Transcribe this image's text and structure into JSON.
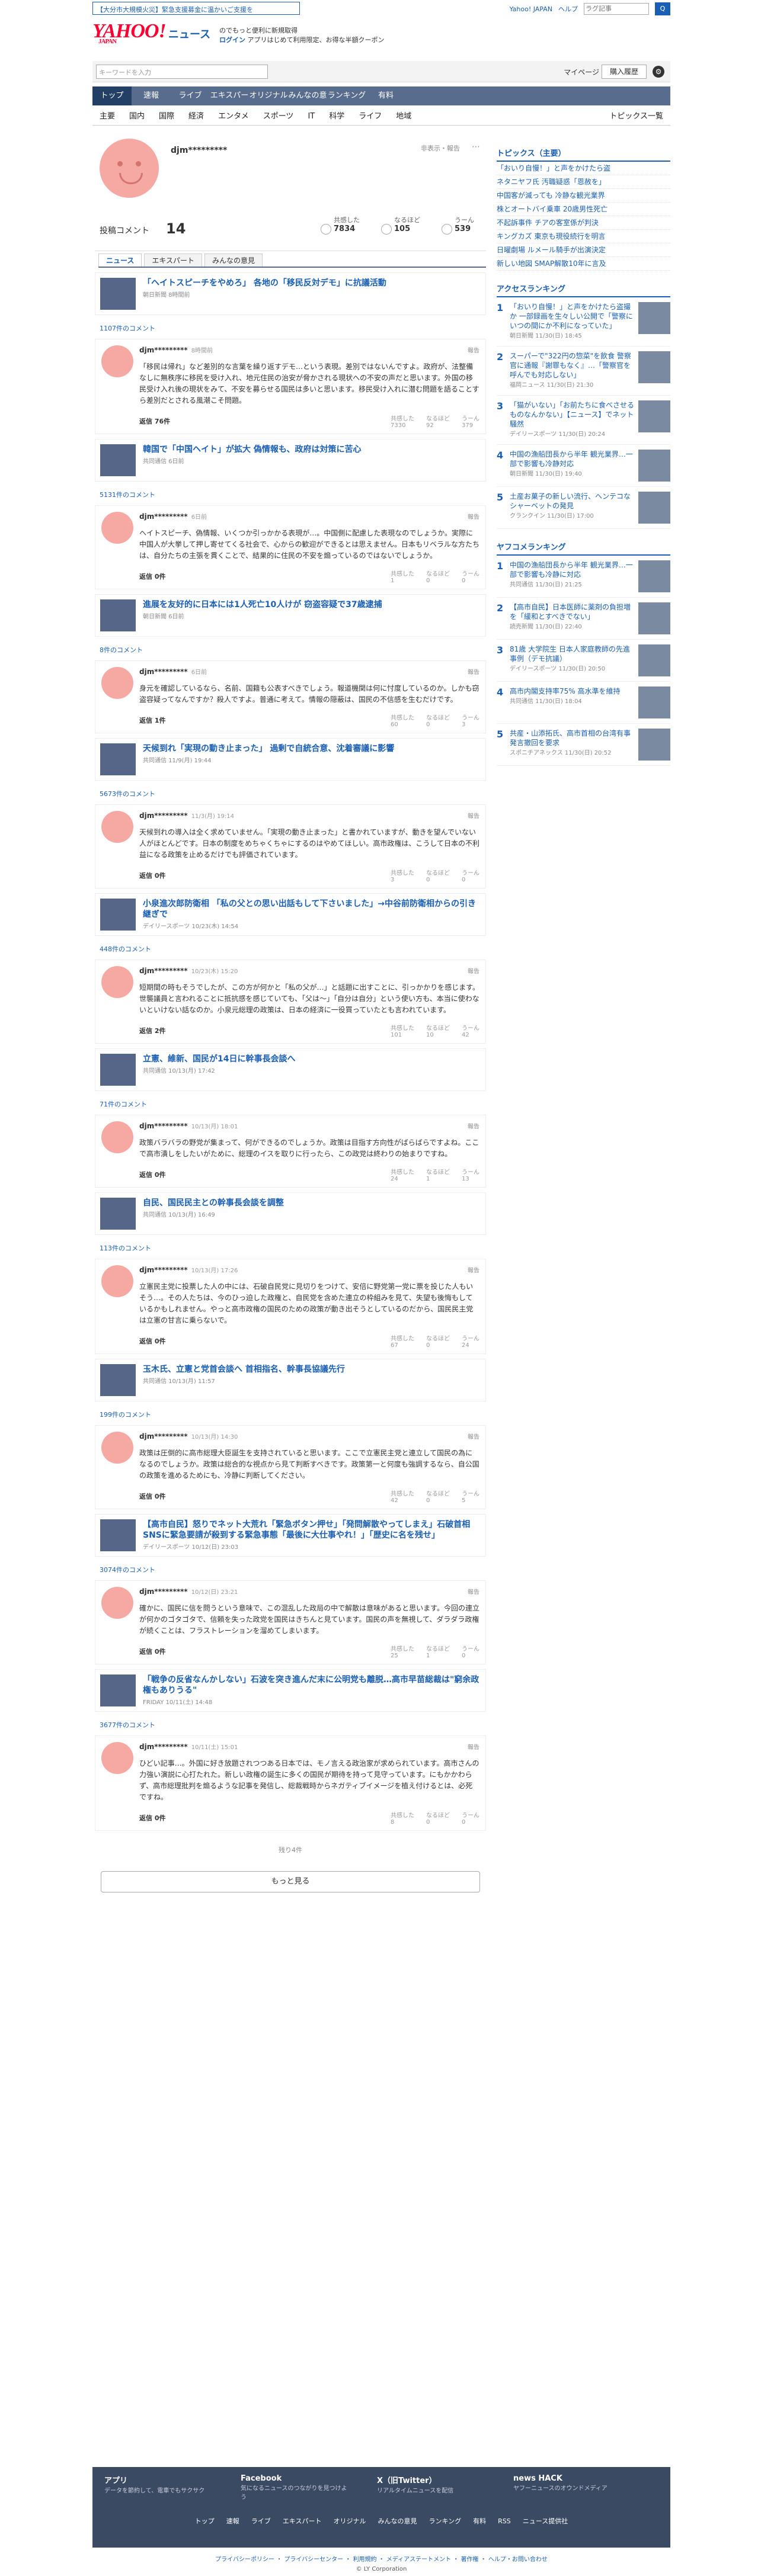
{
  "alert": "【大分市大規模火災】緊急支援募金に温かいご支援を",
  "topright": {
    "yj": "Yahoo! JAPAN",
    "help": "ヘルプ",
    "search_ph": "ラグ記事",
    "search_btn": "Q"
  },
  "brand": {
    "logo": "YAHOO!",
    "sub": "JAPAN",
    "news": "ニュース"
  },
  "promo": {
    "line1": "のでもっと便利に新規取得",
    "login": "ログイン",
    "line2": "アプリはじめて利用限定、お得な半額クーポン"
  },
  "searchbar": {
    "placeholder": "キーワードを入力",
    "mypage": "マイページ",
    "purchase": "購入履歴"
  },
  "gnav": [
    "トップ",
    "速報",
    "ライブ",
    "エキスパート",
    "オリジナル",
    "みんなの意見",
    "ランキング",
    "有料"
  ],
  "subnav": [
    "主要",
    "国内",
    "国際",
    "経済",
    "エンタメ",
    "スポーツ",
    "IT",
    "科学",
    "ライフ",
    "地域"
  ],
  "subnav_right": "トピックス一覧",
  "profile": {
    "name": "djm*********",
    "hide": "非表示・報告",
    "count_label": "投稿コメント",
    "count": "14",
    "s1": "共感した",
    "v1": "7834",
    "s2": "なるほど",
    "v2": "105",
    "s3": "うーん",
    "v3": "539"
  },
  "tabs": [
    "ニュース",
    "エキスパート",
    "みんなの意見"
  ],
  "items": [
    {
      "title": "「ヘイトスピーチをやめろ」 各地の「移民反対デモ」に抗議活動",
      "src": "朝日新聞 8時間前",
      "cc": "1107件のコメント",
      "name": "djm*********",
      "time": "8時間前",
      "text": "「移民は帰れ」など差別的な言葉を繰り返すデモ…という表現。差別ではないんですよ。政府が、法整備なしに無秩序に移民を受け入れ、地元住民の治安が脅かされる現状への不安の声だと思います。外国の移民受け入れ後の現状をみて、不安を募らせる国民は多いと思います。移民受け入れに潜む問題を語ることすら差別だとされる風潮こそ問題。",
      "r1": "7330",
      "r2": "92",
      "r3": "379",
      "reply": "返信 76件"
    },
    {
      "title": "韓国で「中国ヘイト」が拡大 偽情報も、政府は対策に苦心",
      "src": "共同通信 6日前",
      "cc": "5131件のコメント",
      "name": "djm*********",
      "time": "6日前",
      "text": "ヘイトスピーチ、偽情報、いくつか引っかかる表現が…。中国側に配慮した表現なのでしょうか。実際に中国人が大挙して押し寄せてくる社会で、心からの歓迎ができるとは思えません。日本もリベラルな方たちは、自分たちの主張を貫くことで、結果的に住民の不安を煽っているのではないでしょうか。",
      "r1": "1",
      "r2": "0",
      "r3": "0",
      "reply": "返信 0件"
    },
    {
      "title": "進展を友好的に日本には1人死亡10人けが 窃盗容疑で37歳逮捕",
      "src": "朝日新聞 6日前",
      "cc": "8件のコメント",
      "name": "djm*********",
      "time": "6日前",
      "text": "身元を確認しているなら、名前、国籍も公表すべきでしょう。報道機関は何に忖度しているのか。しかも窃盗容疑ってなんですか？殺人ですよ。普通に考えて。情報の隠蔽は、国民の不信感を生むだけです。",
      "r1": "60",
      "r2": "0",
      "r3": "3",
      "reply": "返信 1件"
    },
    {
      "title": "天候到れ「実現の動き止まった」 過剰で自統合意、沈着審議に影響",
      "src": "共同通信 11/9(月) 19:44",
      "cc": "5673件のコメント",
      "name": "djm*********",
      "time": "11/3(月) 19:14",
      "text": "天候到れの導入は全く求めていません。「実現の動き止まった」と書かれていますが、動きを望んでいない人がほとんどです。日本の制度をめちゃくちゃにするのはやめてほしい。高市政権は、こうして日本の不利益になる政策を止めるだけでも評価されています。",
      "r1": "3",
      "r2": "0",
      "r3": "0",
      "reply": "返信 0件"
    },
    {
      "title": "小泉進次郎防衛相 「私の父との思い出話もして下さいました」→中谷前防衛相からの引き継ぎで",
      "src": "デイリースポーツ 10/23(木) 14:54",
      "cc": "448件のコメント",
      "name": "djm*********",
      "time": "10/23(木) 15:20",
      "text": "短期間の時もそうでしたが、この方が何かと「私の父が…」と話題に出すことに、引っかかりを感じます。世襲議員と言われることに抵抗感を感じていても、「父は～」「自分は自分」という使い方も、本当に使わないといけない話なのか。小泉元総理の政策は、日本の経済に一役買っていたとも言われています。",
      "r1": "101",
      "r2": "10",
      "r3": "42",
      "reply": "返信 2件"
    },
    {
      "title": "立憲、維新、国民が14日に幹事長会談へ",
      "src": "共同通信 10/13(月) 17:42",
      "cc": "71件のコメント",
      "name": "djm*********",
      "time": "10/13(月) 18:01",
      "text": "政策バラバラの野党が集まって、何ができるのでしょうか。政策は目指す方向性がばらばらですよね。ここで高市潰しをしたいがために、総理のイスを取りに行ったら、この政党は終わりの始まりですね。",
      "r1": "24",
      "r2": "1",
      "r3": "13",
      "reply": "返信 0件"
    },
    {
      "title": "自民、国民民主との幹事長会談を調整",
      "src": "共同通信 10/13(月) 16:49",
      "cc": "113件のコメント",
      "name": "djm*********",
      "time": "10/13(月) 17:26",
      "text": "立憲民主党に投票した人の中には、石破自民党に見切りをつけて、安倍に野党第一党に票を投じた人もいそう…。その人たちは、今のひっ迫した政権と、自民党を含めた連立の枠組みを見て、失望も後悔もしているかもしれません。やっと高市政権の国民のための政策が動き出そうとしているのだから、国民民主党は立憲の甘言に乗らないで。",
      "r1": "67",
      "r2": "0",
      "r3": "24",
      "reply": "返信 0件"
    },
    {
      "title": "玉木氏、立憲と党首会談へ 首相指名、幹事長協議先行",
      "src": "共同通信 10/13(月) 11:57",
      "cc": "199件のコメント",
      "name": "djm*********",
      "time": "10/13(月) 14:30",
      "text": "政策は圧倒的に高市総理大臣誕生を支持されていると思います。ここで立憲民主党と連立して国民の為になるのでしょうか。政策は総合的な視点から見て判断すべきです。政策第一と何度も強調するなら、自公国の政策を進めるためにも、冷静に判断してください。",
      "r1": "42",
      "r2": "0",
      "r3": "5",
      "reply": "返信 0件"
    },
    {
      "title": "【高市自民】怒りでネット大荒れ「緊急ボタン押せ」「発問解散やってしまえ」石破首相SNSに緊急要請が殺到する緊急事態「最後に大仕事やれ！」「歴史に名を残せ」",
      "src": "デイリースポーツ 10/12(日) 23:03",
      "cc": "3074件のコメント",
      "name": "djm*********",
      "time": "10/12(日) 23:21",
      "text": "確かに、国民に信を問うという意味で、この混乱した政局の中で解散は意味があると思います。今回の連立が何かのゴタゴタで、信頼を失った政党を国民はきちんと見ています。国民の声を無視して、ダラダラ政権が続くことは、フラストレーションを溜めてしまいます。",
      "r1": "25",
      "r2": "1",
      "r3": "0",
      "reply": "返信 0件"
    },
    {
      "title": "「戦争の反省なんかしない」石波を突き進んだ末に公明党も離脱…高市早苗総裁は\"窮余政権もありうる\"",
      "src": "FRIDAY 10/11(土) 14:48",
      "cc": "3677件のコメント",
      "name": "djm*********",
      "time": "10/11(土) 15:01",
      "text": "ひどい記事…。外国に好き放題されつつある日本では、モノ言える政治家が求められています。高市さんの力強い演説に心打たれた。新しい政権の誕生に多くの国民が期待を持って見守っています。にもかかわらず、高市総理批判を煽るような記事を発信し、総裁戦時からネガティブイメージを植え付けるとは、必死ですね。",
      "r1": "8",
      "r2": "0",
      "r3": "0",
      "reply": "返信 0件"
    }
  ],
  "remain": "残り4件",
  "more": "もっと見る",
  "side": {
    "topics_h": "トピックス（主要）",
    "topics": [
      "「おいり自慢！」と声をかけたら盗",
      "ネタニヤフ氏 汚職疑惑「恩赦を」",
      "中国客が減っても 冷静な観光業界",
      "株とオートバイ乗車 20歳男性死亡",
      "不起訴事件 チアの客室係が判決",
      "キングカズ 東京も現役続行を明言",
      "日曜劇場 ルメール騎手が出演決定",
      "新しい地図 SMAP解散10年に言及"
    ],
    "rank_h": "アクセスランキング",
    "rank": [
      [
        "「おいり自慢！」と声をかけたら盗撮か 一部録画を生々しい公開で「警察にいつの間にか不利になっていた」",
        "朝日新聞 11/30(日) 18:45"
      ],
      [
        "スーパーで\"322円の惣菜\"を飲食 警察官に通報『謝罪もなく』…「警察官を呼んでも対応しない」",
        "福岡ニュース 11/30(日) 21:30"
      ],
      [
        "「猫がいない」「お前たちに食べさせるものなんかない」【ニュース】でネット騒然",
        "デイリースポーツ 11/30(日) 20:24"
      ],
      [
        "中国の漁船団長から半年 観光業界…一部で影響も冷静対応",
        "朝日新聞 11/30(日) 19:40"
      ],
      [
        "土産お菓子の新しい流行、ヘンテコなシャーベットの発見",
        "クランクイン 11/30(日) 17:00"
      ]
    ],
    "yah_h": "ヤフコメランキング",
    "yah": [
      [
        "中国の漁船団長から半年 観光業界…一部で影響も冷静に対応",
        "共同通信 11/30(日) 21:25"
      ],
      [
        "【高市自民】日本医師に薬剤の負担増を「緩和とすべきでない」",
        "読売新聞 11/30(日) 22:40"
      ],
      [
        "81歳 大学院生 日本人家庭教師の先進事例（デモ抗議）",
        "デイリースポーツ 11/30(日) 20:50"
      ],
      [
        "高市内閣支持率75% 高水準を維持",
        "共同通信 11/30(日) 18:04"
      ],
      [
        "共産・山添拓氏、高市首相の台湾有事発言撤回を要求",
        "スポニチアネックス 11/30(日) 20:52"
      ]
    ]
  },
  "footer": {
    "a1": "アプリ",
    "a1s": "データを節約して、電車でもサクサク",
    "a2": "Facebook",
    "a2s": "気になるニュースのつながりを見つけよう",
    "a3": "X（旧Twitter）",
    "a3s": "リアルタイムニュースを配信",
    "a4": "news HACK",
    "a4s": "ヤフーニュースのオウンドメディア",
    "links": [
      "トップ",
      "速報",
      "ライブ",
      "エキスパート",
      "オリジナル",
      "みんなの意見",
      "ランキング",
      "有料",
      "RSS",
      "ニュース提供社"
    ]
  },
  "legal": "プライバシーポリシー ・ プライバシーセンター ・ 利用規約 ・ メディアステートメント ・ 著作権 ・ ヘルプ・お問い合わせ",
  "copyright": "© LY Corporation"
}
